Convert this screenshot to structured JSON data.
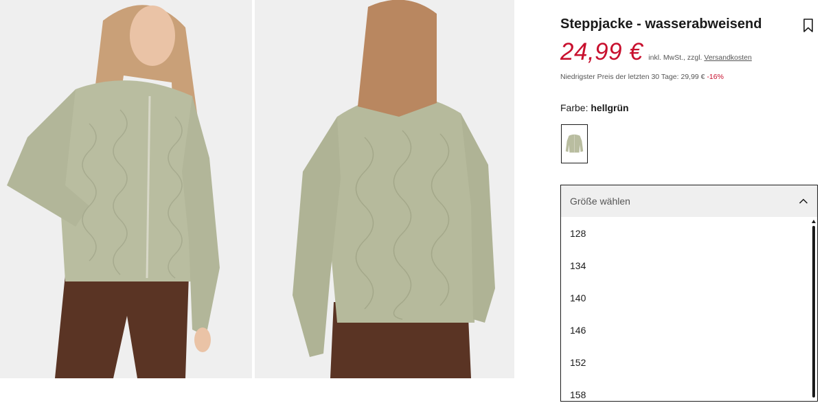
{
  "product": {
    "title": "Steppjacke - wasserabweisend",
    "price": "24,99 €",
    "price_note": "inkl. MwSt., zzgl.",
    "shipping_link": "Versandkosten",
    "lowest_price_text": "Niedrigster Preis der letzten 30 Tage: 29,99 €",
    "discount": "-16%",
    "color_label": "Farbe:",
    "color_value": "hellgrün"
  },
  "gallery": {
    "images": [
      {
        "name": "front-view-photo",
        "jacket_color": "#b9bda0"
      },
      {
        "name": "back-view-photo",
        "jacket_color": "#b6ba9c"
      }
    ],
    "pants_color": "#5a3424"
  },
  "size_select": {
    "placeholder": "Größe wählen",
    "options": [
      "128",
      "134",
      "140",
      "146",
      "152",
      "158"
    ]
  },
  "icons": {
    "bookmark": "bookmark-icon",
    "chevron": "chevron-up-icon"
  },
  "colors": {
    "accent": "#c8102e",
    "text": "#1a1a1a",
    "muted": "#555555",
    "dropdown_header": "#efefef"
  }
}
